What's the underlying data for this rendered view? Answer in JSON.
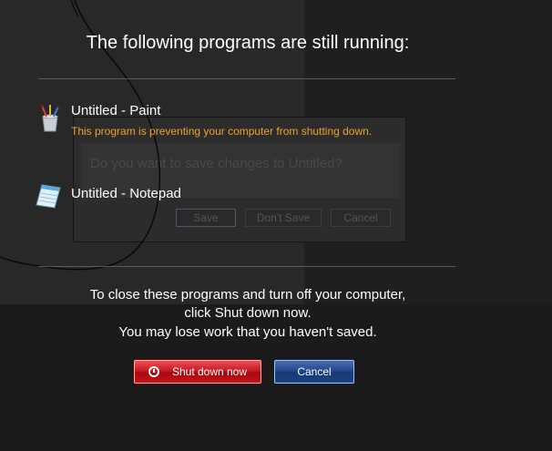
{
  "heading": "The following programs are still running:",
  "programs": [
    {
      "name": "Untitled - Paint",
      "warning": "This program is preventing your computer from shutting down.",
      "icon": "paint-brushes-icon"
    },
    {
      "name": "Untitled - Notepad",
      "icon": "notepad-icon"
    }
  ],
  "background_dialog": {
    "question": "Do you want to save changes to Untitled?",
    "buttons": [
      "Save",
      "Don't Save",
      "Cancel"
    ]
  },
  "message": {
    "line1": "To close these programs and turn off your computer,",
    "line2": "click Shut down now.",
    "line3": "You may lose work that you haven't saved."
  },
  "buttons": {
    "shutdown": "Shut down now",
    "cancel": "Cancel"
  },
  "colors": {
    "warning_text": "#f0a030",
    "shutdown_button": "#c81a22",
    "cancel_button": "#23488e"
  }
}
